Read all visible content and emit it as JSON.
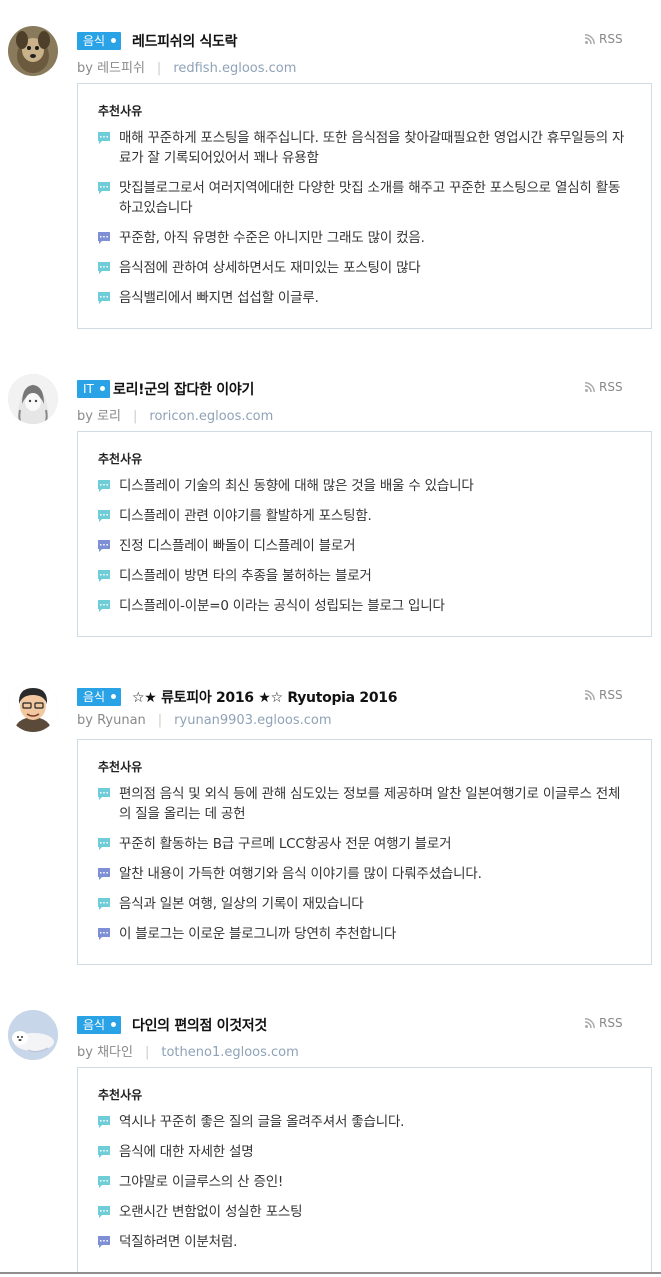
{
  "rss_label": "RSS",
  "box_head": "추천사유",
  "colors": {
    "category": "#2aa3e6",
    "bubble": "#6fcdd7",
    "bubble_alt": "#7e8fd6"
  },
  "entries": [
    {
      "category": "음식",
      "title": "레드피쉬의 식도락",
      "by": "by 레드피쉬",
      "url": "redfish.egloos.com",
      "avatar_icon": "dog-avatar-icon",
      "reasons": [
        "매해 꾸준하게 포스팅을 해주십니다. 또한 음식점을 찾아갈때필요한 영업시간 휴무일등의 자료가 잘 기록되어있어서 꽤나 유용함",
        "맛집블로그로서 여러지역에대한 다양한 맛집 소개를 해주고 꾸준한 포스팅으로 열심히 활동하고있습니다",
        "꾸준함, 아직 유명한 수준은 아니지만 그래도 많이 컸음.",
        "음식점에 관하여 상세하면서도 재미있는 포스팅이 많다",
        "음식밸리에서 빠지면 섭섭할 이글루."
      ]
    },
    {
      "category": "IT",
      "title": "로리!군의 잡다한 이야기",
      "by": "by 로리",
      "url": "roricon.egloos.com",
      "avatar_icon": "anime-girl-avatar-icon",
      "reasons": [
        "디스플레이 기술의 최신 동향에 대해 많은 것을 배울 수 있습니다",
        "디스플레이 관련 이야기를 활발하게 포스팅함.",
        "진정 디스플레이 빠돌이 디스플레이 블로거",
        "디스플레이 방면 타의 추종을 불허하는 블로거",
        "디스플레이-이분=0 이라는 공식이 성립되는 블로그 입니다"
      ]
    },
    {
      "category": "음식",
      "title": "☆★ 류토피아 2016 ★☆ Ryutopia 2016",
      "by": "by Ryunan",
      "url": "ryunan9903.egloos.com",
      "avatar_icon": "cartoon-man-avatar-icon",
      "reasons": [
        "편의점 음식 및 외식 등에 관해 심도있는 정보를 제공하며 알찬 일본여행기로 이글루스 전체의 질을 올리는 데 공헌",
        "꾸준히 활동하는 B급 구르메 LCC항공사 전문 여행기 블로거",
        "알찬 내용이 가득한 여행기와 음식 이야기를 많이 다뤄주셨습니다.",
        "음식과 일본 여행, 일상의 기록이 재밌습니다",
        "이 블로그는 이로운 블로그니까 당연히 추천합니다"
      ]
    },
    {
      "category": "음식",
      "title": "다인의 편의점 이것저것",
      "by": "by 채다인",
      "url": "totheno1.egloos.com",
      "avatar_icon": "seal-avatar-icon",
      "reasons": [
        "역시나 꾸준히 좋은 질의 글을 올려주셔서 좋습니다.",
        "음식에 대한 자세한 설명",
        "그야말로 이글루스의 산 증인!",
        "오랜시간 변함없이 성실한 포스팅",
        "덕질하려면 이분처럼."
      ]
    }
  ]
}
